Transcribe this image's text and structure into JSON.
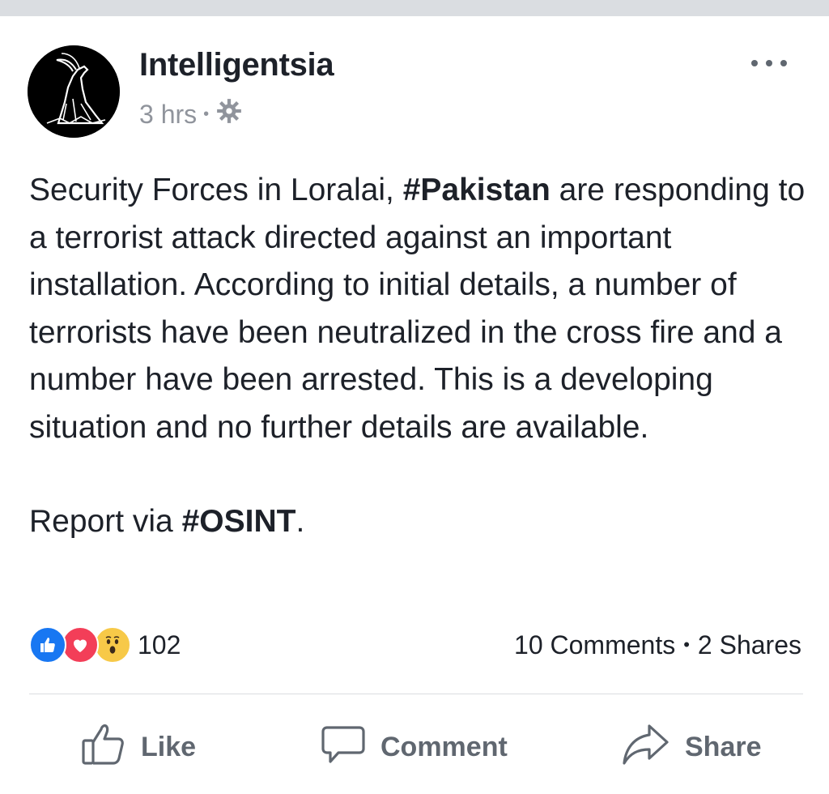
{
  "post": {
    "author": "Intelligentsia",
    "time": "3 hrs",
    "privacy_icon": "gear-icon",
    "body_parts": [
      {
        "text": "Security Forces in Loralai, ",
        "bold": false
      },
      {
        "text": "#Pakistan",
        "bold": true
      },
      {
        "text": " are responding to a terrorist attack directed against an important installation. According to initial details, a number of terrorists have been neutralized in the cross fire and a number have been arrested. This is a developing situation and no further details are available.",
        "bold": false
      }
    ],
    "report_prefix": "Report via ",
    "report_tag": "#OSINT",
    "report_suffix": "."
  },
  "reactions": {
    "icons": [
      "like-reaction-icon",
      "love-reaction-icon",
      "wow-reaction-icon"
    ],
    "count": "102"
  },
  "stats": {
    "comments": "10 Comments",
    "separator": "•",
    "shares": "2 Shares"
  },
  "actions": {
    "like": "Like",
    "comment": "Comment",
    "share": "Share"
  },
  "colors": {
    "like_blue": "#1877f2",
    "love_red": "#f33e58",
    "wow_yellow": "#f7c948",
    "meta_gray": "#90949c",
    "action_gray": "#606770"
  }
}
